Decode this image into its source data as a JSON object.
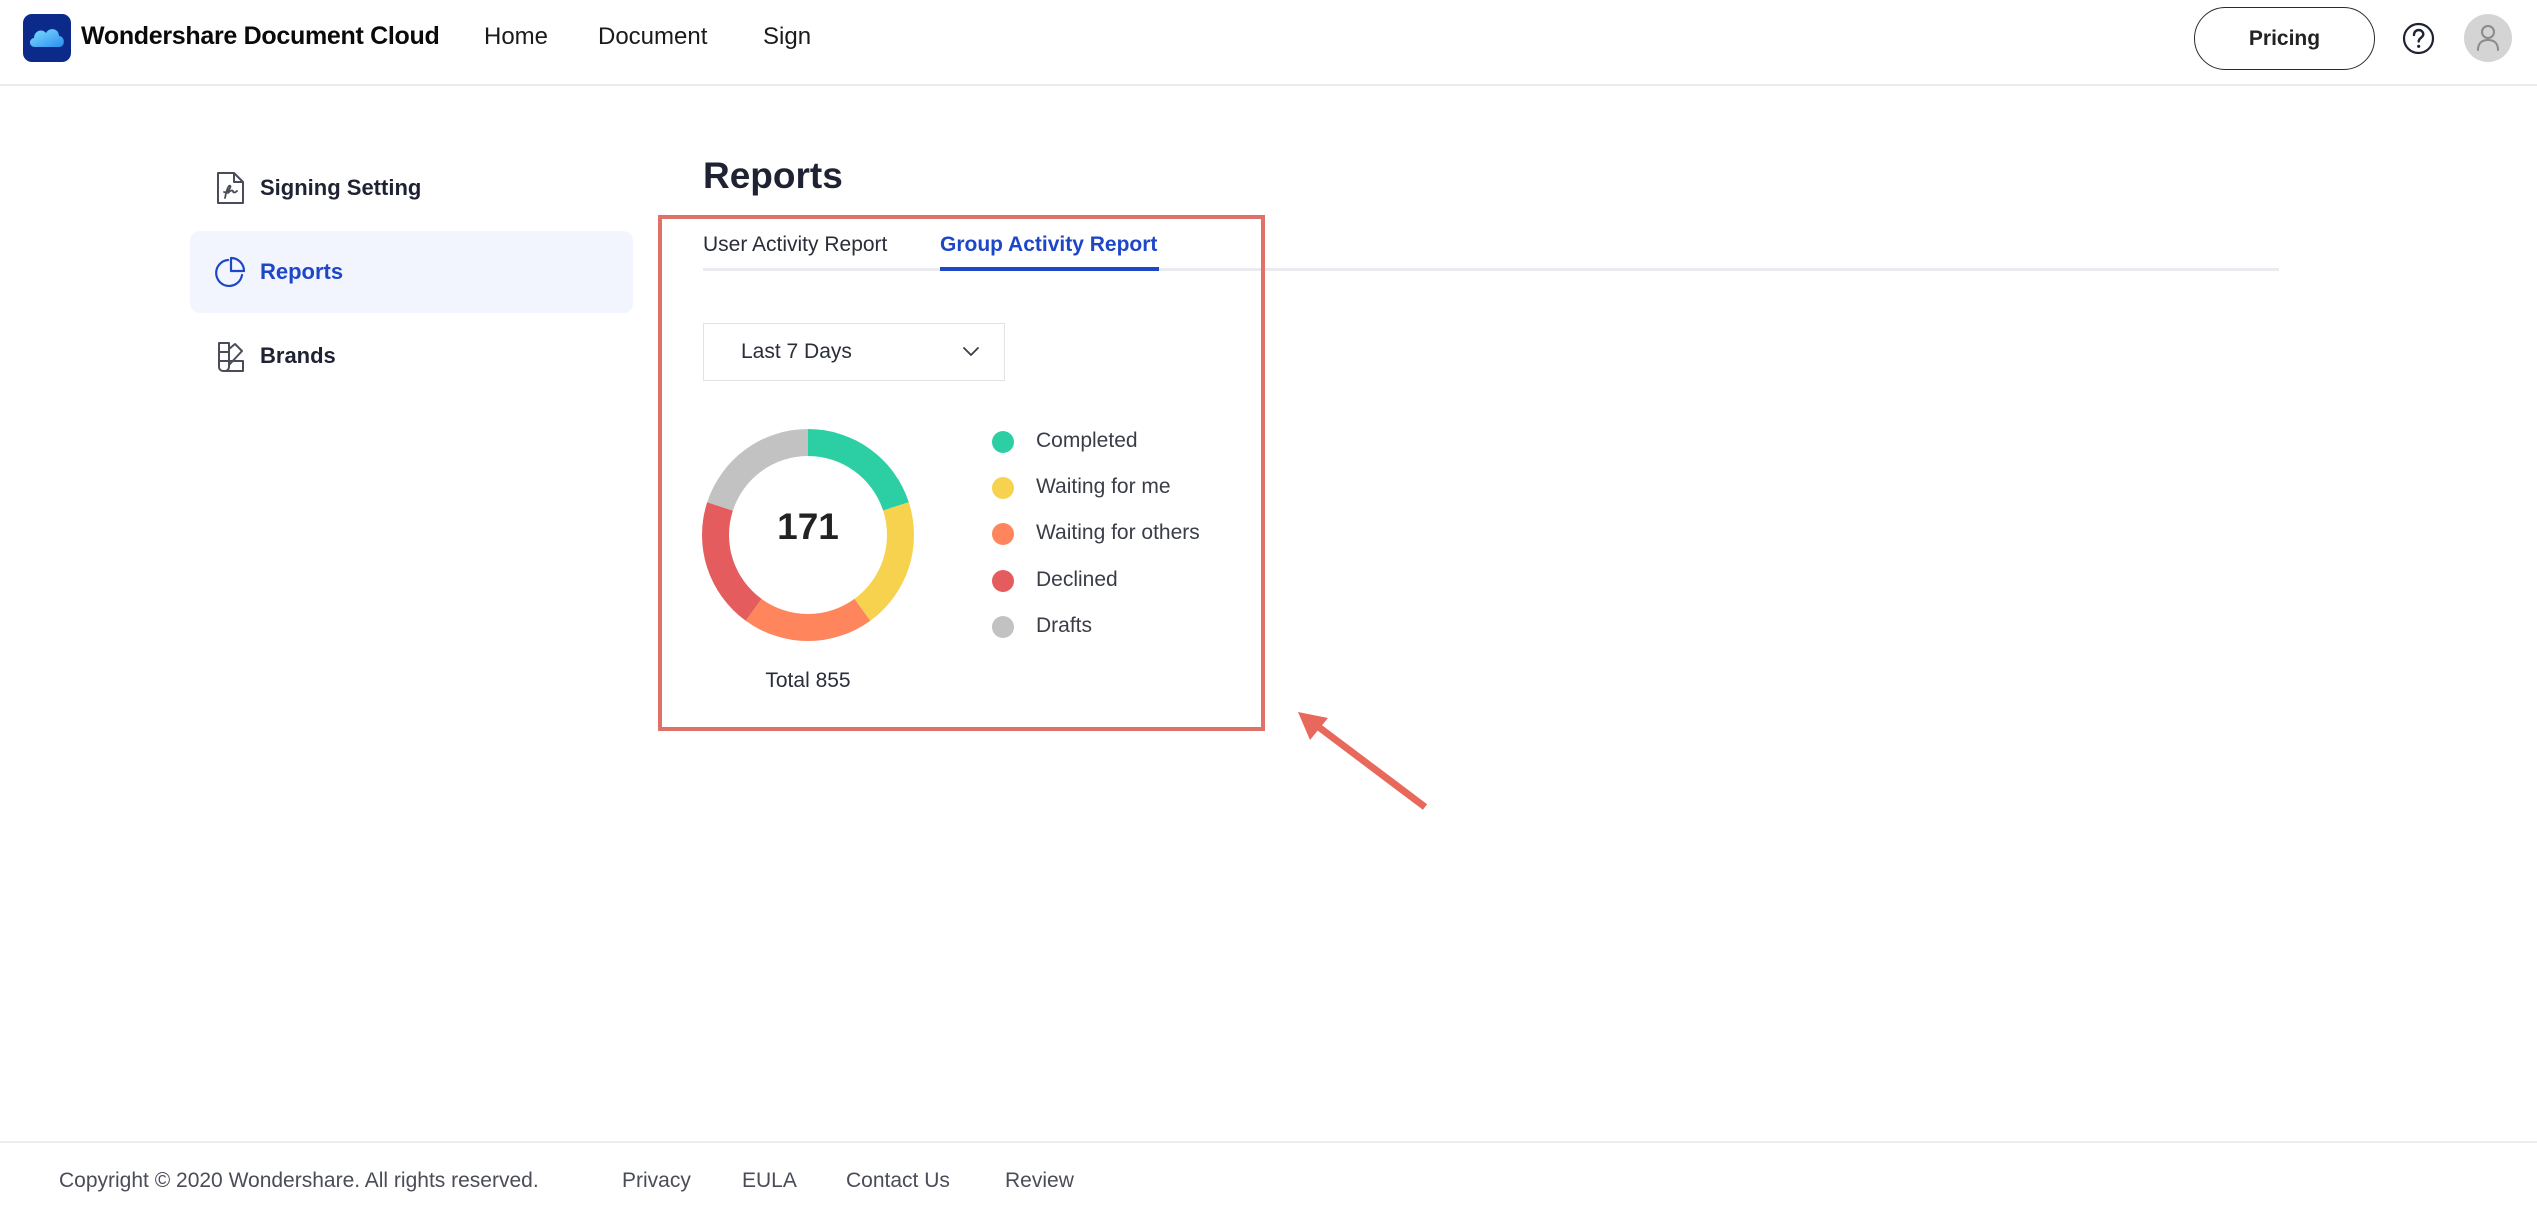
{
  "header": {
    "brand_name": "Wondershare Document Cloud",
    "nav": [
      {
        "label": "Home"
      },
      {
        "label": "Document"
      },
      {
        "label": "Sign"
      }
    ],
    "pricing_label": "Pricing",
    "help_icon": "question-circle-icon",
    "avatar_icon": "user-icon"
  },
  "sidebar": {
    "items": [
      {
        "label": "Signing Setting",
        "icon": "signature-document-icon",
        "active": false
      },
      {
        "label": "Reports",
        "icon": "pie-chart-icon",
        "active": true
      },
      {
        "label": "Brands",
        "icon": "color-swatch-icon",
        "active": false
      }
    ]
  },
  "main": {
    "title": "Reports",
    "tabs": [
      {
        "label": "User Activity Report",
        "active": false
      },
      {
        "label": "Group Activity Report",
        "active": true
      }
    ],
    "date_range": {
      "selected": "Last 7 Days"
    },
    "summary": {
      "center_value": "171",
      "total_label": "Total 855"
    }
  },
  "chart_data": {
    "type": "pie",
    "variant": "donut",
    "title": "",
    "center_label": "171",
    "total": 855,
    "categories": [
      "Completed",
      "Waiting for me",
      "Waiting for others",
      "Declined",
      "Drafts"
    ],
    "values": [
      171,
      171,
      171,
      171,
      171
    ],
    "colors": [
      "#2ccfa3",
      "#f6d24f",
      "#ff855c",
      "#e45c5e",
      "#c2c2c2"
    ],
    "legend": {
      "position": "right",
      "entries": [
        "Completed",
        "Waiting for me",
        "Waiting for others",
        "Declined",
        "Drafts"
      ]
    }
  },
  "colors": {
    "accent": "#1e47c8",
    "active_bg": "#f2f5fd",
    "annotation": "#e07168"
  },
  "footer": {
    "copyright": "Copyright © 2020 Wondershare. All rights reserved.",
    "links": [
      {
        "label": "Privacy"
      },
      {
        "label": "EULA"
      },
      {
        "label": "Contact Us"
      },
      {
        "label": "Review"
      }
    ]
  }
}
